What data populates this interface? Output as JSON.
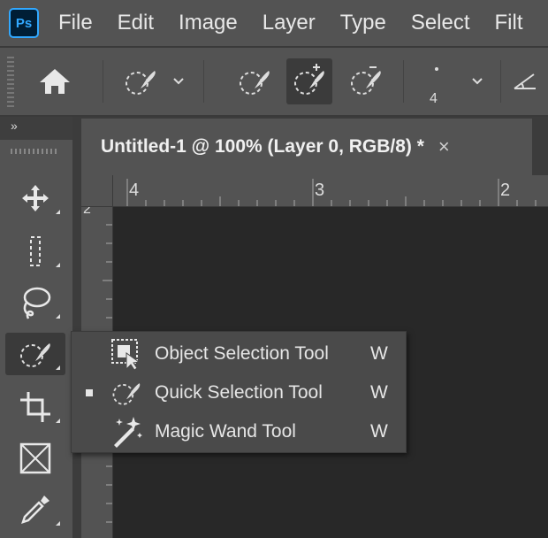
{
  "app": {
    "logo_text": "Ps"
  },
  "menu": [
    "File",
    "Edit",
    "Image",
    "Layer",
    "Type",
    "Select",
    "Filt"
  ],
  "options_bar": {
    "brush_size": "4",
    "icons": [
      "home-icon",
      "quick-selection-preset-icon",
      "new-selection-icon",
      "add-to-selection-icon",
      "subtract-from-selection-icon",
      "brush-size-icon",
      "brush-angle-icon"
    ],
    "active_mode": "add-to-selection"
  },
  "document": {
    "tab_title": "Untitled-1 @ 100% (Layer 0, RGB/8) *",
    "close_glyph": "×"
  },
  "rulers": {
    "horizontal_labels": [
      "4",
      "3",
      "2"
    ],
    "vertical_labels": [
      "2"
    ]
  },
  "toolbar": {
    "collapse_glyph": "»",
    "tools": [
      "move-tool",
      "marquee-tool",
      "lasso-tool",
      "quick-selection-tool",
      "crop-tool",
      "frame-tool",
      "eyedropper-tool"
    ],
    "active_tool": "quick-selection-tool"
  },
  "flyout": {
    "items": [
      {
        "label": "Object Selection Tool",
        "shortcut": "W",
        "selected": false,
        "icon": "object-selection-icon"
      },
      {
        "label": "Quick Selection Tool",
        "shortcut": "W",
        "selected": true,
        "icon": "quick-selection-icon"
      },
      {
        "label": "Magic Wand Tool",
        "shortcut": "W",
        "selected": false,
        "icon": "magic-wand-icon"
      }
    ]
  },
  "colors": {
    "panel": "#535353",
    "dark": "#282828",
    "accent": "#31a8ff"
  }
}
